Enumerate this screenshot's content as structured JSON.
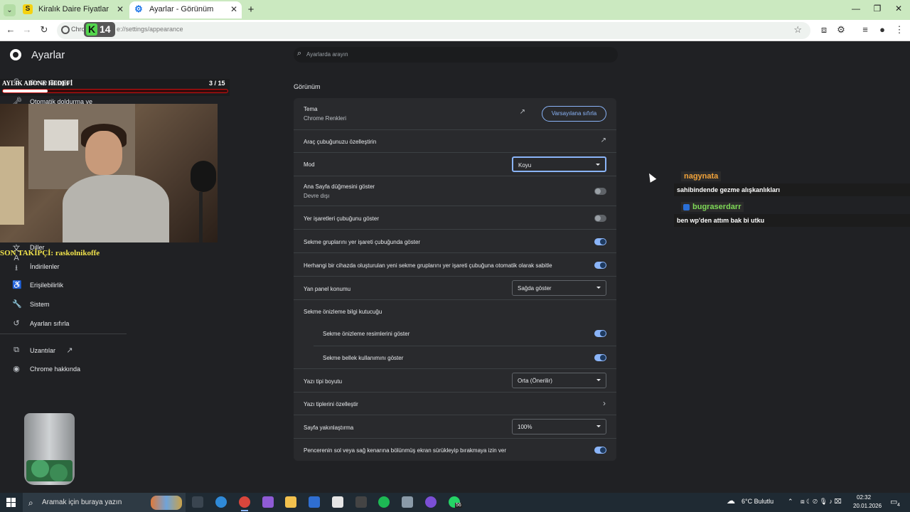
{
  "browser": {
    "tabs": [
      {
        "label": "Kiralık Daire Fiyatları ve Kiralık E",
        "favicon": "S"
      },
      {
        "label": "Ayarlar - Görünüm",
        "favicon": "⚙"
      }
    ],
    "omnibox": {
      "site_label": "Chrome",
      "url": "e://settings/appearance"
    },
    "overlay_badge": {
      "letter": "K",
      "number": "14"
    }
  },
  "settings": {
    "title": "Ayarlar",
    "search_placeholder": "Ayarlarda arayın",
    "sidebar": {
      "items": [
        {
          "label": "Siz ve Google",
          "icon": "G"
        },
        {
          "label": "Otomatik doldurma ve",
          "icon": "🗝"
        },
        {
          "label": "Diller",
          "icon": "文A"
        },
        {
          "label": "İndirilenler",
          "icon": "⭳"
        },
        {
          "label": "Erişilebilirlik",
          "icon": "♿"
        },
        {
          "label": "Sistem",
          "icon": "🔧"
        },
        {
          "label": "Ayarları sıfırla",
          "icon": "↺"
        },
        {
          "label": "Uzantılar",
          "icon": "⧉"
        },
        {
          "label": "Chrome hakkında",
          "icon": "◉"
        }
      ]
    },
    "section_title": "Görünüm",
    "rows": {
      "theme": {
        "label": "Tema",
        "sub": "Chrome Renkleri",
        "reset_label": "Varsayılana sıfırla"
      },
      "toolbar": {
        "label": "Araç çubuğunuzu özelleştirin"
      },
      "mode": {
        "label": "Mod",
        "value": "Koyu"
      },
      "home": {
        "label": "Ana Sayfa düğmesini göster",
        "sub": "Devre dışı",
        "on": false
      },
      "bookmarks": {
        "label": "Yer işaretleri çubuğunu göster",
        "on": false
      },
      "tab_groups": {
        "label": "Sekme gruplarını yer işareti çubuğunda göster",
        "on": true
      },
      "pin_groups": {
        "label": "Herhangi bir cihazda oluşturulan yeni sekme gruplarını yer işareti çubuğuna otomatik olarak sabitle",
        "on": true
      },
      "side_panel": {
        "label": "Yan panel konumu",
        "value": "Sağda göster"
      },
      "hover_card": {
        "label": "Sekme önizleme bilgi kutucuğu"
      },
      "hover_images": {
        "label": "Sekme önizleme resimlerini göster",
        "on": true
      },
      "hover_memory": {
        "label": "Sekme bellek kullanımını göster",
        "on": true
      },
      "font_size": {
        "label": "Yazı tipi boyutu",
        "value": "Orta (Önerilir)"
      },
      "fonts": {
        "label": "Yazı tiplerini özelleştir"
      },
      "zoom": {
        "label": "Sayfa yakınlaştırma",
        "value": "100%"
      },
      "split": {
        "label": "Pencerenin sol veya sağ kenarına bölünmüş ekran sürükleyip bırakmaya izin ver",
        "on": true
      }
    }
  },
  "stream": {
    "sub_goal": {
      "label": "AYLIK ABONE HEDEFİ",
      "count": "3 / 15",
      "progress": 0.2
    },
    "last_follower": "SON TAKİPÇİ: raskolnikoffe",
    "chat": [
      {
        "user": "nagynata",
        "message": "sahibindende gezme alışkanlıkları",
        "color": "#f2a33a"
      },
      {
        "user": "bugraserdarr",
        "message": "ben wp'den attım bak bi utku",
        "color": "#7ed957"
      }
    ]
  },
  "taskbar": {
    "search_placeholder": "Aramak için buraya yazın",
    "weather": "6°C Bulutlu",
    "time": "02:32",
    "date": "20.01.2026",
    "whatsapp_count": "56",
    "notification_count": "4"
  }
}
